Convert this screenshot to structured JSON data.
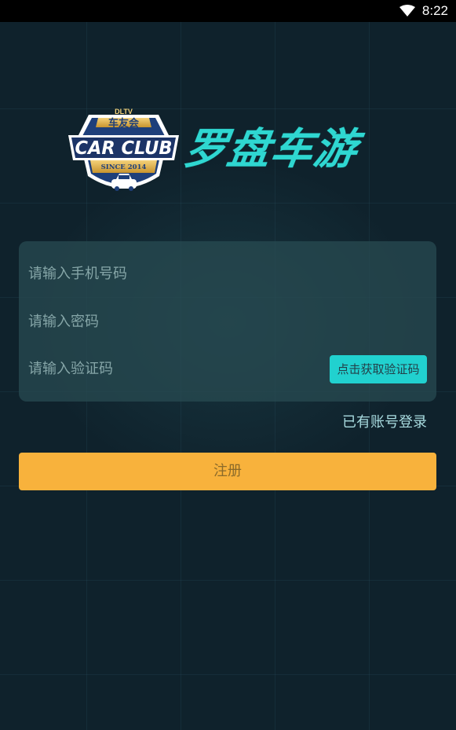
{
  "status_bar": {
    "time": "8:22",
    "wifi_icon": "wifi-icon"
  },
  "logo": {
    "badge_top": "DLTV",
    "badge_cn": "车友会",
    "badge_main": "CAR CLUB",
    "badge_since": "SINCE 2014",
    "app_name": "罗盘车游"
  },
  "form": {
    "phone_placeholder": "请输入手机号码",
    "password_placeholder": "请输入密码",
    "code_placeholder": "请输入验证码",
    "get_code_label": "点击获取验证码"
  },
  "login_link": "已有账号登录",
  "register_label": "注册",
  "colors": {
    "background": "#0f222c",
    "accent": "#21d1cf",
    "register": "#f8b23c"
  }
}
